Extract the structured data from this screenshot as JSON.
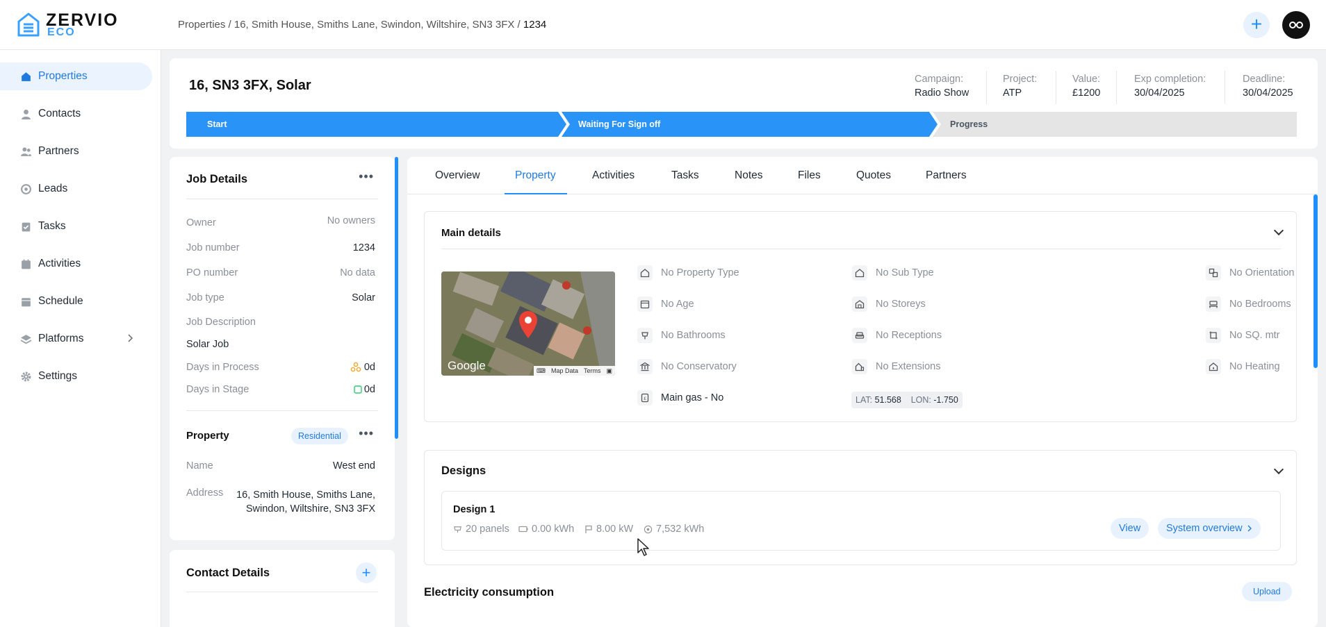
{
  "brand": {
    "name": "ZERVIO",
    "sub": "ECO"
  },
  "breadcrumb": {
    "path": "Properties / 16, Smith House, Smiths Lane, Swindon, Wiltshire, SN3 3FX /",
    "current": "1234"
  },
  "header": {
    "add_label": "+"
  },
  "sidebar": {
    "items": [
      {
        "label": "Properties"
      },
      {
        "label": "Contacts"
      },
      {
        "label": "Partners"
      },
      {
        "label": "Leads"
      },
      {
        "label": "Tasks"
      },
      {
        "label": "Activities"
      },
      {
        "label": "Schedule"
      },
      {
        "label": "Platforms"
      },
      {
        "label": "Settings"
      }
    ]
  },
  "job": {
    "title": "16, SN3 3FX, Solar",
    "meta": [
      {
        "label": "Campaign:",
        "value": "Radio Show"
      },
      {
        "label": "Project:",
        "value": "ATP"
      },
      {
        "label": "Value:",
        "value": "£1200"
      },
      {
        "label": "Exp completion:",
        "value": "30/04/2025"
      },
      {
        "label": "Deadline:",
        "value": "30/04/2025"
      }
    ],
    "stages": [
      "Start",
      "Waiting For Sign off",
      "Progress"
    ]
  },
  "job_details": {
    "title": "Job Details",
    "rows": [
      {
        "label": "Owner",
        "value": "No owners"
      },
      {
        "label": "Job number",
        "value": "1234"
      },
      {
        "label": "PO number",
        "value": "No data"
      },
      {
        "label": "Job type",
        "value": "Solar"
      },
      {
        "label": "Job Description",
        "value": "Solar Job"
      },
      {
        "label": "Days in Process",
        "value": "0d"
      },
      {
        "label": "Days in Stage",
        "value": "0d"
      }
    ]
  },
  "property_card": {
    "title": "Property",
    "badge": "Residential",
    "name_label": "Name",
    "name_value": "West end",
    "address_label": "Address",
    "address_line1": "16, Smith House, Smiths Lane,",
    "address_line2": "Swindon, Wiltshire, SN3 3FX"
  },
  "contact_details": {
    "title": "Contact Details"
  },
  "tabs": [
    "Overview",
    "Property",
    "Activities",
    "Tasks",
    "Notes",
    "Files",
    "Quotes",
    "Partners"
  ],
  "main_details": {
    "title": "Main details",
    "map": {
      "google": "Google",
      "map_data": "Map Data",
      "terms": "Terms"
    },
    "attributes": [
      "No Property Type",
      "No Sub Type",
      "No Orientation",
      "No Age",
      "No Storeys",
      "No Bedrooms",
      "No Bathrooms",
      "No Receptions",
      "No SQ. mtr",
      "No Conservatory",
      "No Extensions",
      "No Heating",
      "Main gas - No"
    ],
    "lat_label": "LAT:",
    "lat": "51.568",
    "lon_label": "LON:",
    "lon": "-1.750"
  },
  "designs": {
    "title": "Designs",
    "design": {
      "name": "Design 1",
      "panels": "20 panels",
      "storage": "0.00 kWh",
      "power": "8.00 kW",
      "yield": "7,532 kWh",
      "view_label": "View",
      "overview_label": "System overview"
    }
  },
  "electricity": {
    "title": "Electricity consumption",
    "upload_label": "Upload"
  }
}
